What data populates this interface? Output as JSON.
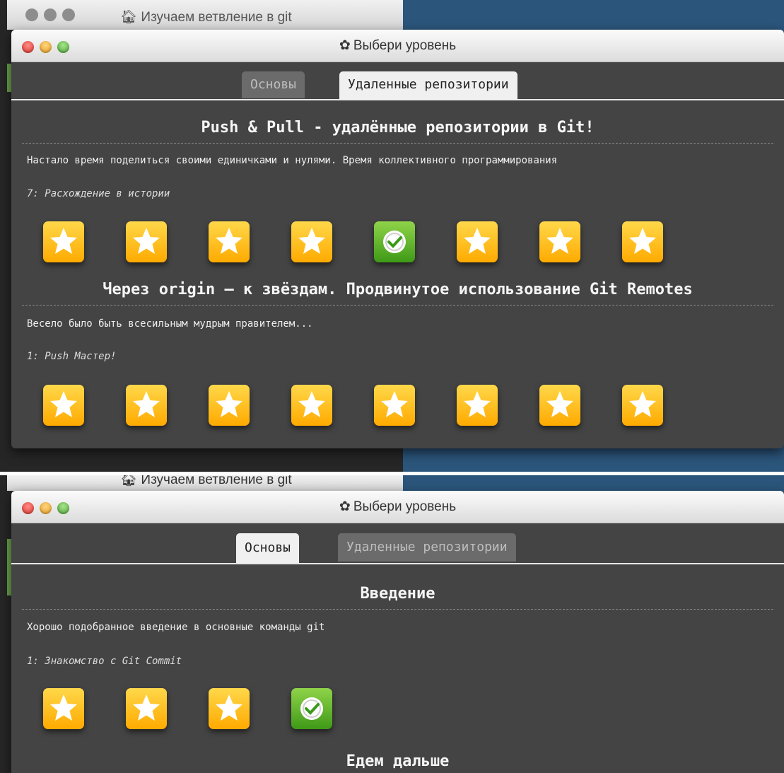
{
  "app_title": "Изучаем ветвление в git",
  "dialog": {
    "title": "Выбери уровень",
    "tabs": [
      "Основы",
      "Удаленные репозитории"
    ]
  },
  "view_remote": {
    "active_tab": "Удаленные репозитории",
    "sections": [
      {
        "title": "Push & Pull - удалённые репозитории в Git!",
        "about": "Настало время поделиться своими единичками и нулями. Время коллективного программирования",
        "selected_level": "7: Расхождение в истории",
        "levels": [
          "star",
          "star",
          "star",
          "star",
          "solved",
          "star",
          "star",
          "star"
        ]
      },
      {
        "title": "Через origin – к звёздам. Продвинутое использование Git Remotes",
        "about": "Весело было быть всесильным мудрым правителем...",
        "selected_level": "1: Push Мастер!",
        "levels": [
          "star",
          "star",
          "star",
          "star",
          "star",
          "star",
          "star",
          "star"
        ]
      }
    ]
  },
  "view_basic": {
    "active_tab": "Основы",
    "sections": [
      {
        "title": "Введение",
        "about": "Хорошо подобранное введение в основные команды git",
        "selected_level": "1: Знакомство с Git Commit",
        "levels": [
          "star",
          "star",
          "star",
          "solved"
        ]
      },
      {
        "title": "Едем дальше"
      }
    ]
  },
  "icons": {
    "window_controls": [
      "close-icon",
      "minimize-icon",
      "maximize-icon"
    ],
    "title_icon": "gear-icon",
    "level_unsolved": "star-icon",
    "level_solved": "checkmark-icon"
  },
  "colors": {
    "modal_bg": "#444444",
    "star_tile": "#ffbf1f",
    "solved_tile": "#5fb52a"
  }
}
